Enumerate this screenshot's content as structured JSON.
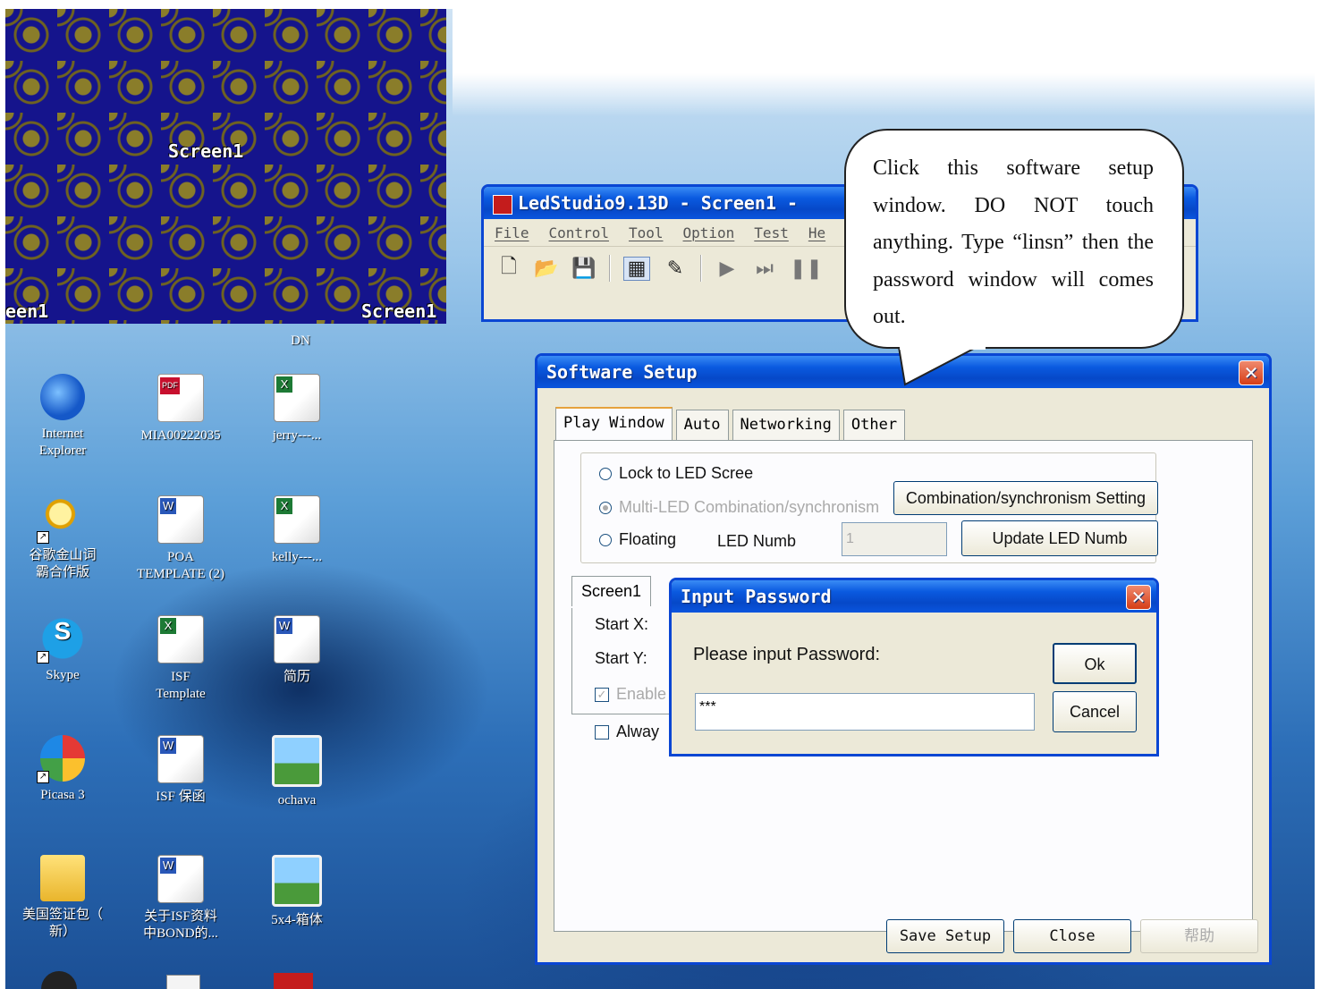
{
  "led_screen": {
    "label_center": "Screen1",
    "label_left": "een1",
    "label_right": "Screen1"
  },
  "desktop_icons": [
    {
      "label": "DN",
      "icon": "doc-icon"
    },
    {
      "label": "Internet\nExplorer",
      "icon": "internet-explorer-icon"
    },
    {
      "label": "MIA00222035",
      "icon": "pdf-file-icon"
    },
    {
      "label": "jerry---...",
      "icon": "excel-file-icon"
    },
    {
      "label": "谷歌金山词\n霸合作版",
      "icon": "dictionary-search-icon"
    },
    {
      "label": "POA\nTEMPLATE (2)",
      "icon": "word-file-icon"
    },
    {
      "label": "kelly---...",
      "icon": "excel-file-icon"
    },
    {
      "label": "Skype",
      "icon": "skype-icon"
    },
    {
      "label": "ISF\nTemplate",
      "icon": "excel-file-icon"
    },
    {
      "label": "简历",
      "icon": "word-file-icon"
    },
    {
      "label": "Picasa 3",
      "icon": "picasa-icon"
    },
    {
      "label": "ISF 保函",
      "icon": "word-file-icon"
    },
    {
      "label": "ochava",
      "icon": "image-file-icon"
    },
    {
      "label": "美国签证包（\n新）",
      "icon": "folder-icon"
    },
    {
      "label": "关于ISF资料\n中BOND的...",
      "icon": "word-file-icon"
    },
    {
      "label": "5x4-箱体",
      "icon": "image-file-icon"
    }
  ],
  "ledstudio": {
    "title": "LedStudio9.13D - Screen1 -",
    "menu": [
      "File",
      "Control",
      "Tool",
      "Option",
      "Test",
      "He"
    ]
  },
  "setup": {
    "title": "Software Setup",
    "tabs": [
      "Play Window",
      "Auto",
      "Networking",
      "Other"
    ],
    "radio_lock": "Lock to LED Scree",
    "radio_multi": "Multi-LED Combination/synchronism",
    "radio_floating": "Floating",
    "combination_button": "Combination/synchronism Setting",
    "led_numb_label": "LED Numb",
    "led_numb_value": "1",
    "update_button": "Update LED Numb",
    "subtab": "Screen1",
    "start_x": "Start X:",
    "start_y": "Start Y:",
    "enable": "Enable",
    "always": "Alway",
    "save_button": "Save Setup",
    "close_button": "Close",
    "help_button": "帮助"
  },
  "password_dialog": {
    "title": "Input Password",
    "prompt": "Please input Password:",
    "value": "***",
    "ok": "Ok",
    "cancel": "Cancel"
  },
  "callout": {
    "text": "Click this software setup window. DO NOT touch anything. Type “linsn” then the password window will comes out."
  },
  "colors": {
    "xp_title_blue": "#0a5ae0",
    "xp_close_red": "#d63d16",
    "led_background": "#15148c",
    "led_pattern": "#8a7d2a"
  }
}
